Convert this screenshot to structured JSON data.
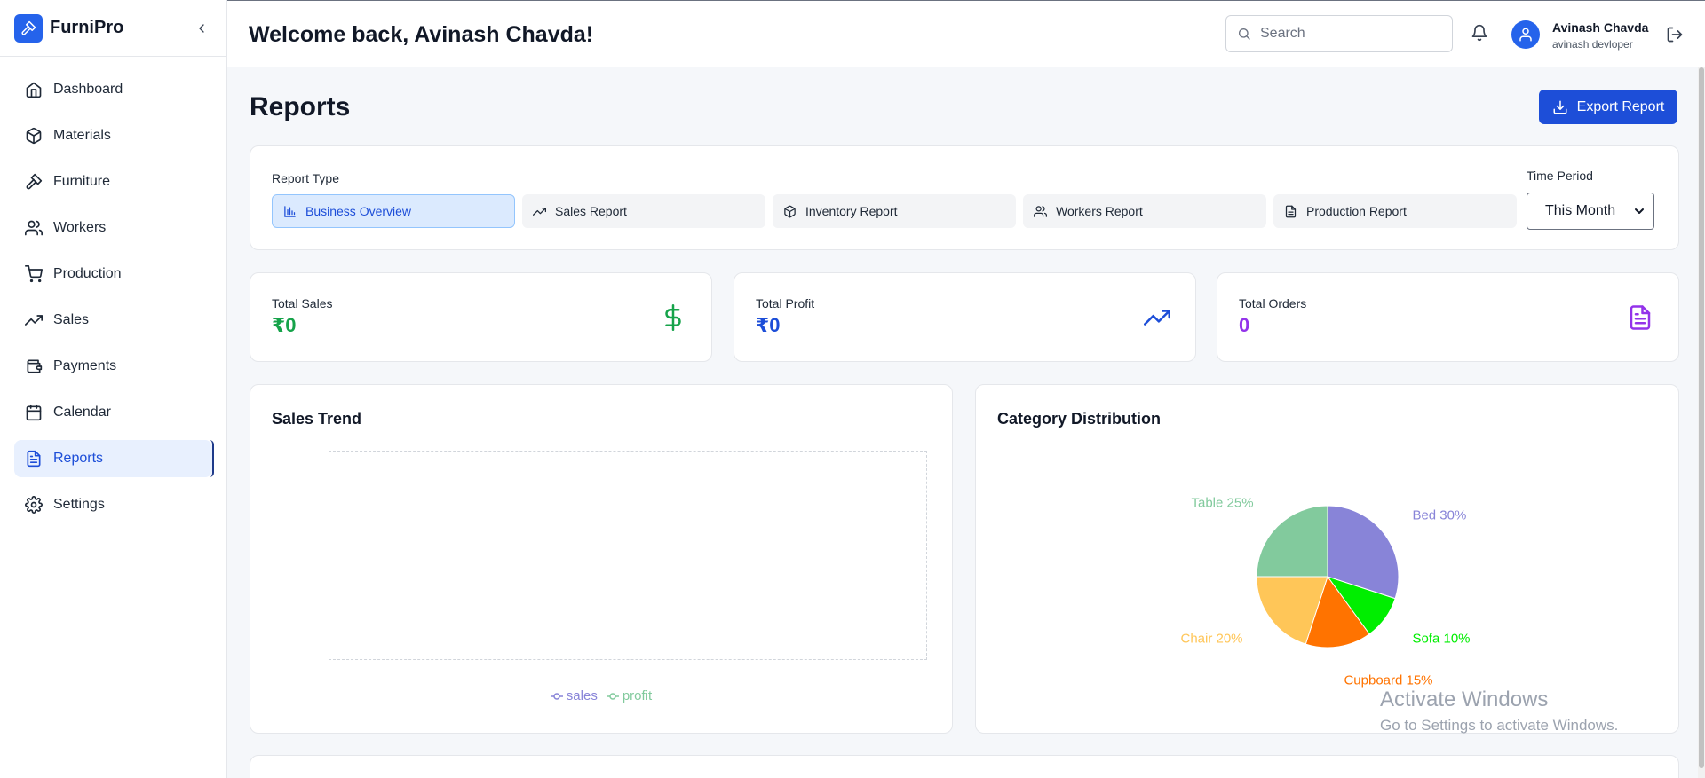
{
  "app": {
    "name": "FurniPro"
  },
  "sidebar": {
    "items": [
      {
        "label": "Dashboard",
        "icon": "home-icon"
      },
      {
        "label": "Materials",
        "icon": "box-icon"
      },
      {
        "label": "Furniture",
        "icon": "hammer-icon"
      },
      {
        "label": "Workers",
        "icon": "users-icon"
      },
      {
        "label": "Production",
        "icon": "cart-icon"
      },
      {
        "label": "Sales",
        "icon": "trending-up-icon"
      },
      {
        "label": "Payments",
        "icon": "wallet-icon"
      },
      {
        "label": "Calendar",
        "icon": "calendar-icon"
      },
      {
        "label": "Reports",
        "icon": "file-text-icon",
        "active": true
      },
      {
        "label": "Settings",
        "icon": "gear-icon"
      }
    ]
  },
  "header": {
    "welcome": "Welcome back, Avinash Chavda!",
    "search_placeholder": "Search",
    "user_name": "Avinash Chavda",
    "user_role": "avinash devloper"
  },
  "page": {
    "title": "Reports",
    "export_label": "Export Report"
  },
  "filters": {
    "report_type_label": "Report Type",
    "types": [
      {
        "label": "Business Overview",
        "icon": "bar-chart-icon",
        "active": true
      },
      {
        "label": "Sales Report",
        "icon": "trending-up-icon"
      },
      {
        "label": "Inventory Report",
        "icon": "box-icon"
      },
      {
        "label": "Workers Report",
        "icon": "users-icon"
      },
      {
        "label": "Production Report",
        "icon": "file-text-icon"
      }
    ],
    "time_period_label": "Time Period",
    "time_period_value": "This Month"
  },
  "stats": [
    {
      "label": "Total Sales",
      "value": "₹0",
      "color": "#16a34a",
      "icon": "dollar-icon"
    },
    {
      "label": "Total Profit",
      "value": "₹0",
      "color": "#1d4ed8",
      "icon": "trending-up-icon"
    },
    {
      "label": "Total Orders",
      "value": "0",
      "color": "#9333ea",
      "icon": "file-text-icon"
    }
  ],
  "sales_trend": {
    "title": "Sales Trend",
    "legend": [
      {
        "label": "sales",
        "color": "#8884d8"
      },
      {
        "label": "profit",
        "color": "#82ca9d"
      }
    ]
  },
  "category_distribution": {
    "title": "Category Distribution",
    "chart_data": {
      "type": "pie",
      "slices": [
        {
          "label": "Bed 30%",
          "name": "Bed",
          "value": 30,
          "color": "#8884d8"
        },
        {
          "label": "Sofa 10%",
          "name": "Sofa",
          "value": 10,
          "color": "#00ee00"
        },
        {
          "label": "Cupboard 15%",
          "name": "Cupboard",
          "value": 15,
          "color": "#ff7300"
        },
        {
          "label": "Chair 20%",
          "name": "Chair",
          "value": 20,
          "color": "#ffc658"
        },
        {
          "label": "Table 25%",
          "name": "Table",
          "value": 25,
          "color": "#82ca9d"
        }
      ]
    }
  },
  "watermark": {
    "line1": "Activate Windows",
    "line2": "Go to Settings to activate Windows."
  }
}
